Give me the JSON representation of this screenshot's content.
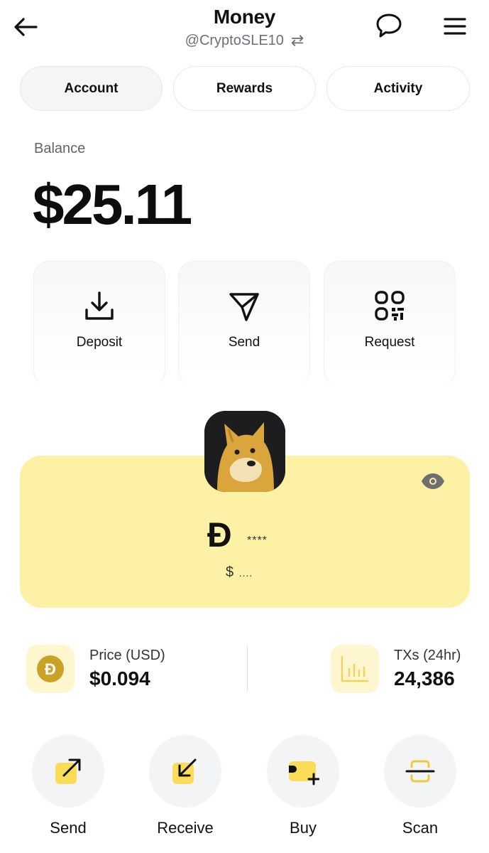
{
  "header": {
    "title": "Money",
    "username": "@CryptoSLE10",
    "swap_icon": "⇄"
  },
  "tabs": [
    {
      "label": "Account",
      "active": true
    },
    {
      "label": "Rewards",
      "active": false
    },
    {
      "label": "Activity",
      "active": false
    }
  ],
  "balance": {
    "label": "Balance",
    "amount": "$25.11"
  },
  "actions": [
    {
      "label": "Deposit",
      "icon": "download-icon"
    },
    {
      "label": "Send",
      "icon": "paper-plane-icon"
    },
    {
      "label": "Request",
      "icon": "qr-code-icon"
    }
  ],
  "doge_card": {
    "symbol": "Đ",
    "masked_amount": "****",
    "usd_symbol": "$",
    "masked_usd": "....",
    "background": "#fcf1a4"
  },
  "stats": {
    "price": {
      "label": "Price (USD)",
      "value": "$0.094",
      "icon": "doge-coin-icon"
    },
    "txs": {
      "label": "TXs (24hr)",
      "value": "24,386",
      "icon": "bar-chart-icon"
    }
  },
  "bottom_actions": [
    {
      "label": "Send",
      "icon": "send-arrow-icon"
    },
    {
      "label": "Receive",
      "icon": "receive-arrow-icon"
    },
    {
      "label": "Buy",
      "icon": "buy-card-icon"
    },
    {
      "label": "Scan",
      "icon": "scan-icon"
    }
  ],
  "colors": {
    "accent_yellow": "#fadc56",
    "coin_gold": "#c9a227"
  }
}
